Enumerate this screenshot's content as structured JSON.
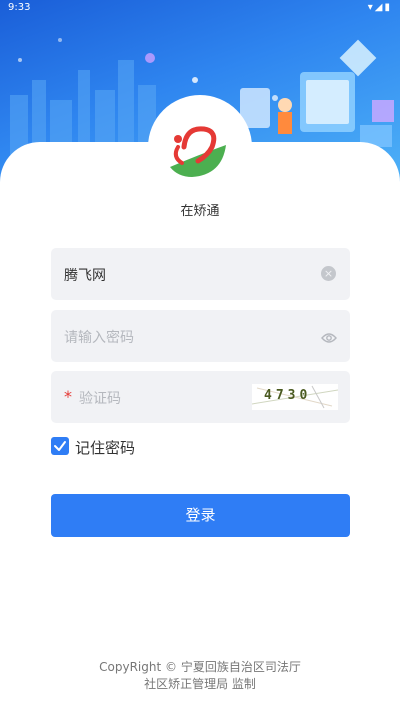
{
  "status_bar": {
    "time": "9:33",
    "icons": "▾◢▮"
  },
  "app": {
    "name": "在矫通"
  },
  "form": {
    "username_value": "腾飞网",
    "password_placeholder": "请输入密码",
    "captcha_required_mark": "*",
    "captcha_placeholder": "验证码",
    "captcha_text": "4730",
    "remember_label": "记住密码",
    "remember_checked": true,
    "login_label": "登录"
  },
  "footer": {
    "line1": "CopyRight © 宁夏回族自治区司法厅",
    "line2": "社区矫正管理局 监制"
  },
  "colors": {
    "accent": "#2f7df5",
    "field_bg": "#f1f2f5",
    "required": "#e53935"
  }
}
